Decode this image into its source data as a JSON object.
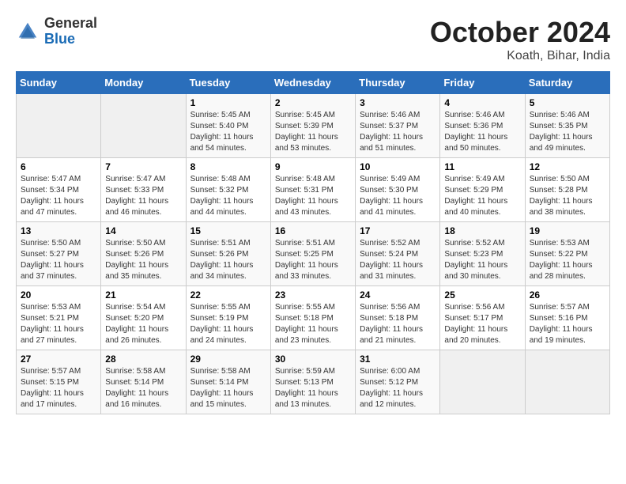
{
  "header": {
    "logo_line1": "General",
    "logo_line2": "Blue",
    "title": "October 2024",
    "subtitle": "Koath, Bihar, India"
  },
  "columns": [
    "Sunday",
    "Monday",
    "Tuesday",
    "Wednesday",
    "Thursday",
    "Friday",
    "Saturday"
  ],
  "weeks": [
    [
      {
        "day": "",
        "info": ""
      },
      {
        "day": "",
        "info": ""
      },
      {
        "day": "1",
        "info": "Sunrise: 5:45 AM\nSunset: 5:40 PM\nDaylight: 11 hours\nand 54 minutes."
      },
      {
        "day": "2",
        "info": "Sunrise: 5:45 AM\nSunset: 5:39 PM\nDaylight: 11 hours\nand 53 minutes."
      },
      {
        "day": "3",
        "info": "Sunrise: 5:46 AM\nSunset: 5:37 PM\nDaylight: 11 hours\nand 51 minutes."
      },
      {
        "day": "4",
        "info": "Sunrise: 5:46 AM\nSunset: 5:36 PM\nDaylight: 11 hours\nand 50 minutes."
      },
      {
        "day": "5",
        "info": "Sunrise: 5:46 AM\nSunset: 5:35 PM\nDaylight: 11 hours\nand 49 minutes."
      }
    ],
    [
      {
        "day": "6",
        "info": "Sunrise: 5:47 AM\nSunset: 5:34 PM\nDaylight: 11 hours\nand 47 minutes."
      },
      {
        "day": "7",
        "info": "Sunrise: 5:47 AM\nSunset: 5:33 PM\nDaylight: 11 hours\nand 46 minutes."
      },
      {
        "day": "8",
        "info": "Sunrise: 5:48 AM\nSunset: 5:32 PM\nDaylight: 11 hours\nand 44 minutes."
      },
      {
        "day": "9",
        "info": "Sunrise: 5:48 AM\nSunset: 5:31 PM\nDaylight: 11 hours\nand 43 minutes."
      },
      {
        "day": "10",
        "info": "Sunrise: 5:49 AM\nSunset: 5:30 PM\nDaylight: 11 hours\nand 41 minutes."
      },
      {
        "day": "11",
        "info": "Sunrise: 5:49 AM\nSunset: 5:29 PM\nDaylight: 11 hours\nand 40 minutes."
      },
      {
        "day": "12",
        "info": "Sunrise: 5:50 AM\nSunset: 5:28 PM\nDaylight: 11 hours\nand 38 minutes."
      }
    ],
    [
      {
        "day": "13",
        "info": "Sunrise: 5:50 AM\nSunset: 5:27 PM\nDaylight: 11 hours\nand 37 minutes."
      },
      {
        "day": "14",
        "info": "Sunrise: 5:50 AM\nSunset: 5:26 PM\nDaylight: 11 hours\nand 35 minutes."
      },
      {
        "day": "15",
        "info": "Sunrise: 5:51 AM\nSunset: 5:26 PM\nDaylight: 11 hours\nand 34 minutes."
      },
      {
        "day": "16",
        "info": "Sunrise: 5:51 AM\nSunset: 5:25 PM\nDaylight: 11 hours\nand 33 minutes."
      },
      {
        "day": "17",
        "info": "Sunrise: 5:52 AM\nSunset: 5:24 PM\nDaylight: 11 hours\nand 31 minutes."
      },
      {
        "day": "18",
        "info": "Sunrise: 5:52 AM\nSunset: 5:23 PM\nDaylight: 11 hours\nand 30 minutes."
      },
      {
        "day": "19",
        "info": "Sunrise: 5:53 AM\nSunset: 5:22 PM\nDaylight: 11 hours\nand 28 minutes."
      }
    ],
    [
      {
        "day": "20",
        "info": "Sunrise: 5:53 AM\nSunset: 5:21 PM\nDaylight: 11 hours\nand 27 minutes."
      },
      {
        "day": "21",
        "info": "Sunrise: 5:54 AM\nSunset: 5:20 PM\nDaylight: 11 hours\nand 26 minutes."
      },
      {
        "day": "22",
        "info": "Sunrise: 5:55 AM\nSunset: 5:19 PM\nDaylight: 11 hours\nand 24 minutes."
      },
      {
        "day": "23",
        "info": "Sunrise: 5:55 AM\nSunset: 5:18 PM\nDaylight: 11 hours\nand 23 minutes."
      },
      {
        "day": "24",
        "info": "Sunrise: 5:56 AM\nSunset: 5:18 PM\nDaylight: 11 hours\nand 21 minutes."
      },
      {
        "day": "25",
        "info": "Sunrise: 5:56 AM\nSunset: 5:17 PM\nDaylight: 11 hours\nand 20 minutes."
      },
      {
        "day": "26",
        "info": "Sunrise: 5:57 AM\nSunset: 5:16 PM\nDaylight: 11 hours\nand 19 minutes."
      }
    ],
    [
      {
        "day": "27",
        "info": "Sunrise: 5:57 AM\nSunset: 5:15 PM\nDaylight: 11 hours\nand 17 minutes."
      },
      {
        "day": "28",
        "info": "Sunrise: 5:58 AM\nSunset: 5:14 PM\nDaylight: 11 hours\nand 16 minutes."
      },
      {
        "day": "29",
        "info": "Sunrise: 5:58 AM\nSunset: 5:14 PM\nDaylight: 11 hours\nand 15 minutes."
      },
      {
        "day": "30",
        "info": "Sunrise: 5:59 AM\nSunset: 5:13 PM\nDaylight: 11 hours\nand 13 minutes."
      },
      {
        "day": "31",
        "info": "Sunrise: 6:00 AM\nSunset: 5:12 PM\nDaylight: 11 hours\nand 12 minutes."
      },
      {
        "day": "",
        "info": ""
      },
      {
        "day": "",
        "info": ""
      }
    ]
  ]
}
